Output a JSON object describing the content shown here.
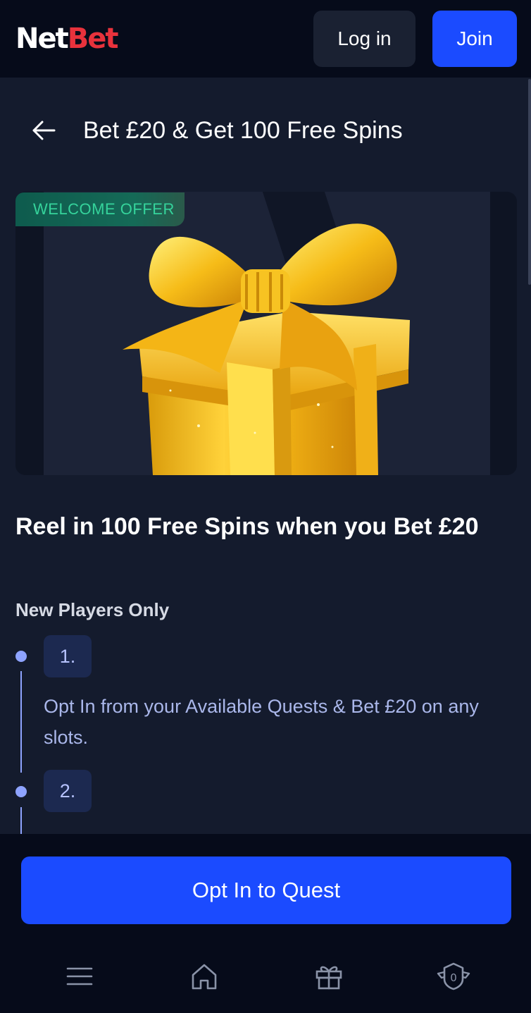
{
  "header": {
    "logo_part1": "Net",
    "logo_part2": "Bet",
    "login_label": "Log in",
    "join_label": "Join"
  },
  "page": {
    "title": "Bet £20 & Get 100 Free Spins",
    "back_icon": "arrow-left-icon"
  },
  "hero": {
    "badge": "WELCOME OFFER",
    "image": "gold-gift-box"
  },
  "content": {
    "headline": "Reel in 100 Free Spins when you Bet £20",
    "subheading": "New Players Only",
    "steps": [
      {
        "number": "1.",
        "text": "Opt In from your Available Quests & Bet £20 on any slots."
      },
      {
        "number": "2.",
        "text": ""
      }
    ]
  },
  "cta": {
    "label": "Opt In to Quest"
  },
  "bottom_nav": {
    "items": [
      {
        "icon": "menu-icon"
      },
      {
        "icon": "home-icon"
      },
      {
        "icon": "gift-icon"
      },
      {
        "icon": "shield-badge-icon",
        "count": "0"
      }
    ]
  },
  "colors": {
    "background": "#141b2d",
    "header": "#060b1a",
    "accent": "#1b4bff",
    "brand_red": "#e8323c",
    "badge_text": "#35d39b",
    "step_accent": "#8ea3ff"
  }
}
